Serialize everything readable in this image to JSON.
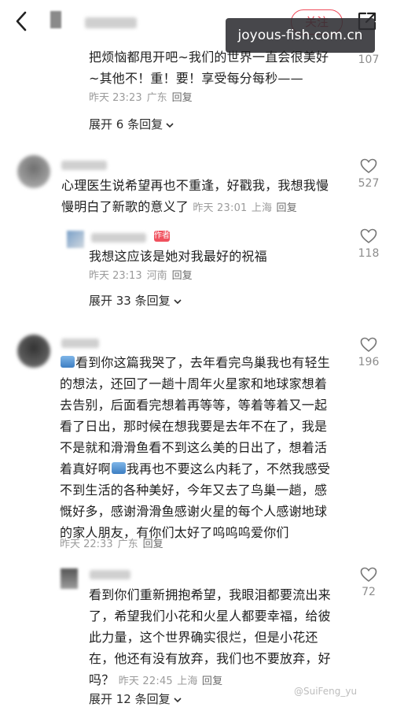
{
  "header": {
    "follow_label": "关注",
    "watermark": "joyous-fish.com.cn"
  },
  "comments": [
    {
      "text_lines": [
        "把烦恼都甩开吧~我们的世界一直会很美好",
        "~其他不！重！要！享受每分每秒——"
      ],
      "time": "昨天 23:23",
      "location": "广东",
      "reply": "回复",
      "likes": "107",
      "expand": "展开 6 条回复"
    },
    {
      "text_lines": [
        "心理医生说希望再也不重逢，好戳我，我想我慢",
        "慢明白了新歌的意义了"
      ],
      "time": "昨天 23:01",
      "location": "上海",
      "reply": "回复",
      "likes": "527",
      "sub": {
        "author_tag": "作者",
        "text": "我想这应该是她对我最好的祝福",
        "time": "昨天 23:13",
        "location": "河南",
        "reply": "回复",
        "likes": "118"
      },
      "expand": "展开 33 条回复"
    },
    {
      "text_lines": [
        "看到你这篇我哭了，去年看完鸟巢我也有轻生",
        "的想法，还回了一趟十周年火星家和地球家想着",
        "去告别，后面看完想着再等等，等着等着又一起",
        "看了日出，那时候在想我要是去年不在了，我是",
        "不是就和滑滑鱼看不到这么美的日出了，想着活",
        "着真好啊",
        "我再也不要这么内耗了，不然我感受",
        "不到生活的各种美好，今年又去了鸟巢一趟，感",
        "慨好多，感谢滑滑鱼感谢火星的每个人感谢地球",
        "的家人朋友，有你们太好了呜呜呜爱你们"
      ],
      "time": "昨天 22:33",
      "location": "广东",
      "reply": "回复",
      "likes": "196",
      "sub": {
        "text_lines": [
          "看到你们重新拥抱希望，我眼泪都要流出来",
          "了，希望我们小花和火星人都要幸福，给彼",
          "此力量，这个世界确实很烂，但是小花还",
          "在，他还有没有放弃，我们也不要放弃，好",
          "吗？"
        ],
        "time": "昨天 22:45",
        "location": "上海",
        "reply": "回复",
        "likes": "72"
      },
      "expand": "展开 12 条回复"
    }
  ],
  "credit": "@SuiFeng_yu",
  "colors": {
    "accent": "#f04b5a",
    "meta": "#9b9b9b"
  },
  "icons": [
    "back-arrow-icon",
    "share-icon",
    "heart-icon",
    "chevron-down-icon"
  ]
}
